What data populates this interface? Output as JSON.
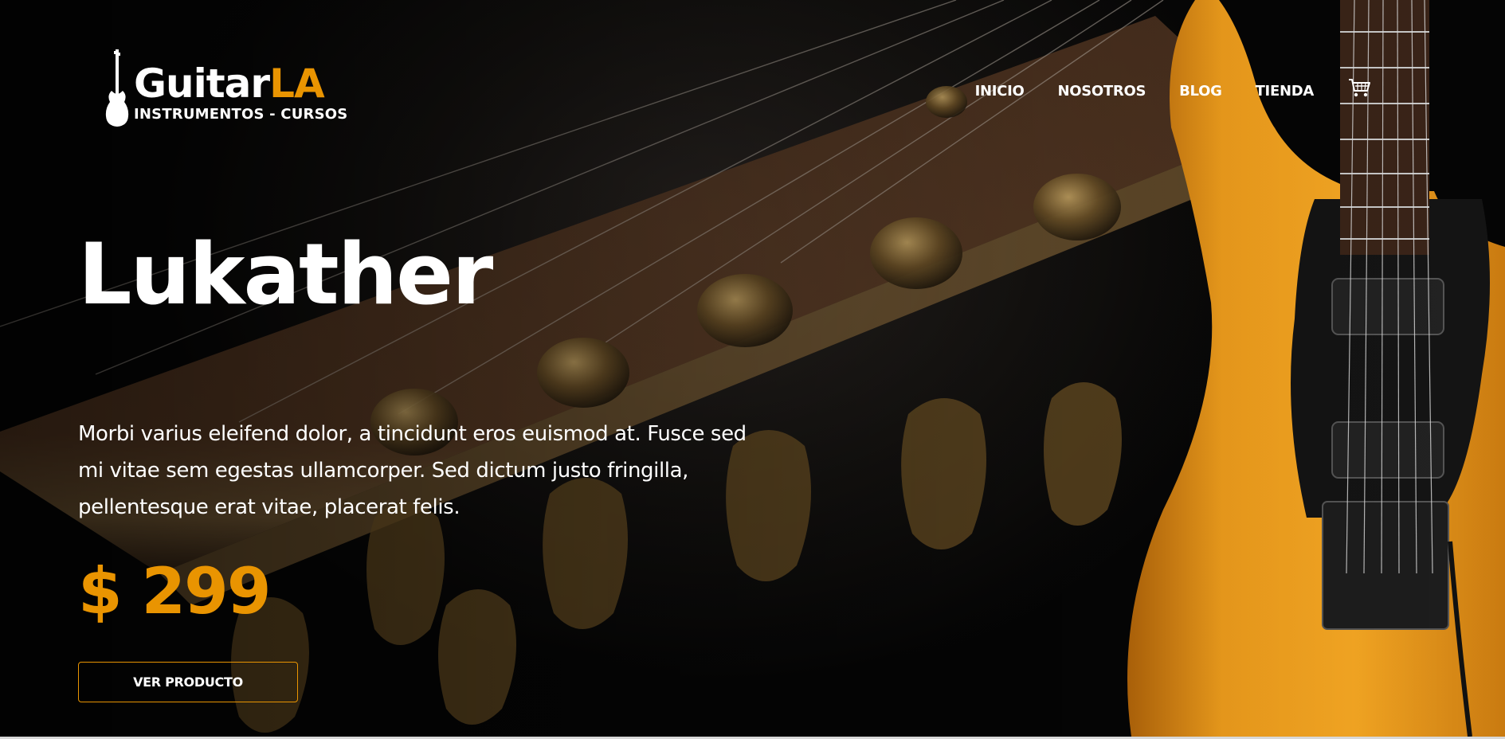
{
  "header": {
    "logo": {
      "name_main": "Guitar",
      "name_accent": "LA",
      "tagline": "INSTRUMENTOS - CURSOS"
    },
    "nav": [
      {
        "label": "INICIO"
      },
      {
        "label": "NOSOTROS"
      },
      {
        "label": "BLOG"
      },
      {
        "label": "TIENDA"
      }
    ],
    "cart_icon": "cart-icon"
  },
  "hero": {
    "title": "Lukather",
    "description": "Morbi varius eleifend dolor, a tincidunt eros euismod at. Fusce sed mi vitae sem egestas ullamcorper. Sed dictum justo fringilla, pellentesque erat vitae, placerat felis.",
    "price": "$ 299",
    "button_label": "VER PRODUCTO"
  },
  "colors": {
    "accent": "#e99401",
    "background": "#050505",
    "text": "#ffffff",
    "guitar_body": "#f39a17"
  }
}
